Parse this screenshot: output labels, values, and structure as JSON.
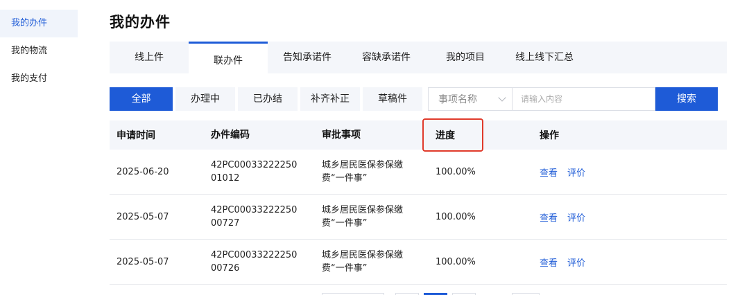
{
  "sidebar": {
    "items": [
      {
        "label": "我的办件",
        "active": true
      },
      {
        "label": "我的物流",
        "active": false
      },
      {
        "label": "我的支付",
        "active": false
      }
    ]
  },
  "page": {
    "title": "我的办件"
  },
  "tabs": [
    {
      "label": "线上件"
    },
    {
      "label": "联办件"
    },
    {
      "label": "告知承诺件"
    },
    {
      "label": "容缺承诺件"
    },
    {
      "label": "我的项目"
    },
    {
      "label": "线上线下汇总"
    }
  ],
  "active_tab": "联办件",
  "filters": {
    "buttons": [
      {
        "label": "全部"
      },
      {
        "label": "办理中"
      },
      {
        "label": "已办结"
      },
      {
        "label": "补齐补正"
      },
      {
        "label": "草稿件"
      }
    ],
    "select_value": "事项名称",
    "input_placeholder": "请输入内容",
    "search_label": "搜索"
  },
  "table": {
    "headers": [
      "申请时间",
      "办件编码",
      "审批事项",
      "进度",
      "操作"
    ],
    "rows": [
      {
        "date": "2025-06-20",
        "code_line1": "42PC00033222250",
        "code_line2": "01012",
        "item_line1": "城乡居民医保参保缴",
        "item_line2": "费“一件事”",
        "progress": "100.00%",
        "view": "查看",
        "rate": "评价"
      },
      {
        "date": "2025-05-07",
        "code_line1": "42PC00033222250",
        "code_line2": "00727",
        "item_line1": "城乡居民医保参保缴",
        "item_line2": "费“一件事”",
        "progress": "100.00%",
        "view": "查看",
        "rate": "评价"
      },
      {
        "date": "2025-05-07",
        "code_line1": "42PC00033222250",
        "code_line2": "00726",
        "item_line1": "城乡居民医保参保缴",
        "item_line2": "费“一件事”",
        "progress": "100.00%",
        "view": "查看",
        "rate": "评价"
      }
    ]
  },
  "colors": {
    "accent": "#1e5bd7",
    "highlight_box": "#e03a2b"
  }
}
